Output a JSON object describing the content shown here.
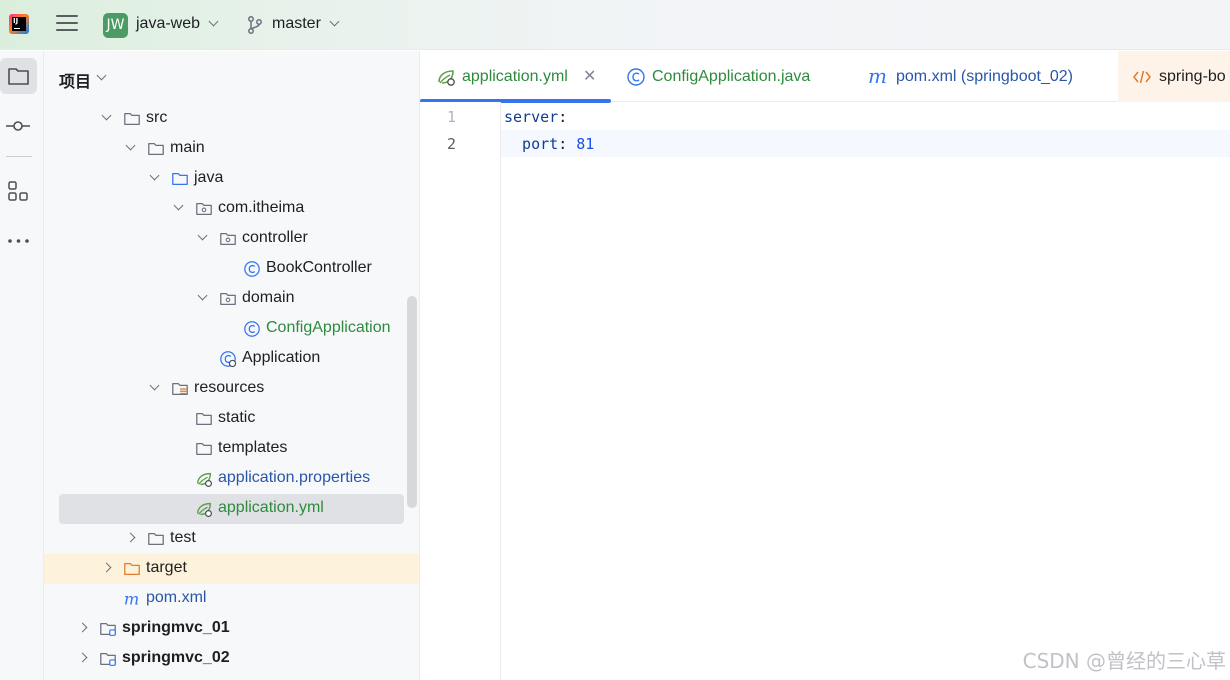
{
  "titlebar": {
    "project_badge": "JW",
    "project_name": "java-web",
    "branch": "master"
  },
  "panel": {
    "title": "项目"
  },
  "tree": [
    {
      "label": "src",
      "icon": "folder-icon",
      "arrow": "down",
      "style": ""
    },
    {
      "label": "main",
      "icon": "folder-icon",
      "arrow": "down",
      "style": ""
    },
    {
      "label": "java",
      "icon": "source-folder-icon",
      "arrow": "down",
      "style": ""
    },
    {
      "label": "com.itheima",
      "icon": "package-icon",
      "arrow": "down",
      "style": ""
    },
    {
      "label": "controller",
      "icon": "package-icon",
      "arrow": "down",
      "style": ""
    },
    {
      "label": "BookController",
      "icon": "class-icon",
      "arrow": "none",
      "style": ""
    },
    {
      "label": "domain",
      "icon": "package-icon",
      "arrow": "down",
      "style": ""
    },
    {
      "label": "ConfigApplication",
      "icon": "class-icon",
      "arrow": "none",
      "style": "green"
    },
    {
      "label": "Application",
      "icon": "spring-boot-class-icon",
      "arrow": "none",
      "style": ""
    },
    {
      "label": "resources",
      "icon": "resources-folder-icon",
      "arrow": "down",
      "style": ""
    },
    {
      "label": "static",
      "icon": "folder-icon",
      "arrow": "none",
      "style": ""
    },
    {
      "label": "templates",
      "icon": "folder-icon",
      "arrow": "none",
      "style": ""
    },
    {
      "label": "application.properties",
      "icon": "spring-config-icon",
      "arrow": "none",
      "style": "blue"
    },
    {
      "label": "application.yml",
      "icon": "spring-config-icon",
      "arrow": "none",
      "style": "green"
    },
    {
      "label": "test",
      "icon": "folder-icon",
      "arrow": "right",
      "style": ""
    },
    {
      "label": "target",
      "icon": "excluded-folder-icon",
      "arrow": "right",
      "style": ""
    },
    {
      "label": "pom.xml",
      "icon": "maven-icon",
      "arrow": "none",
      "style": "blue"
    },
    {
      "label": "springmvc_01",
      "icon": "module-folder-icon",
      "arrow": "right",
      "style": "bold"
    },
    {
      "label": "springmvc_02",
      "icon": "module-folder-icon",
      "arrow": "right",
      "style": "bold"
    }
  ],
  "tabs": [
    {
      "label": "application.yml",
      "icon": "spring-config-icon",
      "active": true
    },
    {
      "label": "ConfigApplication.java",
      "icon": "class-icon",
      "active": false
    },
    {
      "label": "pom.xml (springboot_02)",
      "icon": "maven-icon",
      "active": false
    },
    {
      "label": "spring-bo",
      "icon": "html-tag-icon",
      "active": false
    }
  ],
  "editor": {
    "line_numbers": [
      "1",
      "2"
    ],
    "lines": [
      {
        "key": "server",
        "punct": ":",
        "value": ""
      },
      {
        "key": "  port",
        "punct": ": ",
        "value": "81"
      }
    ]
  },
  "watermark": "CSDN @曾经的三心草"
}
